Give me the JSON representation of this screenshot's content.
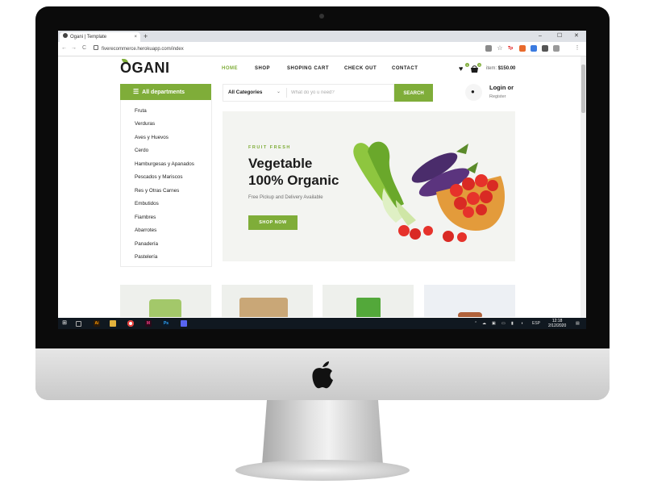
{
  "browser": {
    "tab_title": "Ogani | Template",
    "tab_close": "×",
    "new_tab": "+",
    "url": "fiverecommerce.herokuapp.com/index",
    "nav": {
      "back": "←",
      "forward": "→",
      "reload": "C"
    },
    "window_controls": {
      "minimize": "–",
      "maximize": "☐",
      "close": "✕"
    },
    "extensions": [
      "Tp"
    ]
  },
  "site": {
    "logo": "OGANI",
    "menu": [
      {
        "label": "HOME",
        "active": true
      },
      {
        "label": "SHOP"
      },
      {
        "label": "SHOPING CART"
      },
      {
        "label": "CHECK OUT"
      },
      {
        "label": "CONTACT"
      }
    ],
    "cart": {
      "wish_count": "1",
      "cart_count": "3",
      "item_label": "item:",
      "item_total": "$150.00"
    },
    "departments": {
      "button_label": "All departments",
      "items": [
        "Fruta",
        "Verduras",
        "Aves y Huevos",
        "Cerdo",
        "Hamburgesas y Apanados",
        "Pescados y Mariscos",
        "Res y Otras Carnes",
        "Embutidos",
        "Fiambres",
        "Abarrotes",
        "Panadería",
        "Pastelería"
      ]
    },
    "search": {
      "category": "All Categories",
      "placeholder": "What do yo u need?",
      "button": "SEARCH"
    },
    "account": {
      "login": "Login or",
      "register": "Register"
    },
    "hero": {
      "tag": "FRUIT FRESH",
      "title_line1": "Vegetable",
      "title_line2": "100% Organic",
      "subtitle": "Free Pickup and Delivery Available",
      "button": "SHOP NOW"
    }
  },
  "taskbar": {
    "time": "12:18",
    "date": "2/12/2020",
    "lang": "ESP",
    "apps": [
      "Ai",
      "M",
      "Ps"
    ]
  },
  "colors": {
    "accent": "#7fad39",
    "dark": "#1c1c1c"
  }
}
